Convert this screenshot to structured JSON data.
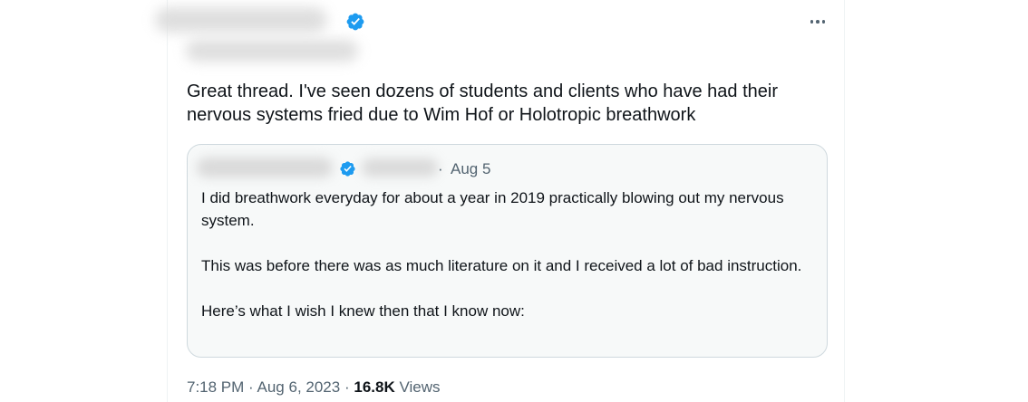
{
  "tweet": {
    "text": "Great thread. I've seen dozens of students and clients who have had their nervous systems fried due to Wim Hof or Holotropic breathwork",
    "time": "7:18 PM",
    "separator": "·",
    "date": "Aug 6, 2023",
    "views_count": "16.8K",
    "views_label": "Views"
  },
  "quote": {
    "separator": "·",
    "date": "Aug 5",
    "paragraphs": [
      "I did breathwork everyday for about a year in 2019 practically blowing out my nervous system.",
      "This was before there was as much literature on it and I received a lot of bad instruction.",
      "Here’s what I wish I knew then that I know now:"
    ]
  },
  "colors": {
    "verified_blue": "#1d9bf0",
    "secondary_text": "#536471",
    "primary_text": "#0f1419",
    "border": "#cfd9de"
  },
  "icons": {
    "verified": "verified-badge-icon",
    "more": "more-options-icon"
  }
}
